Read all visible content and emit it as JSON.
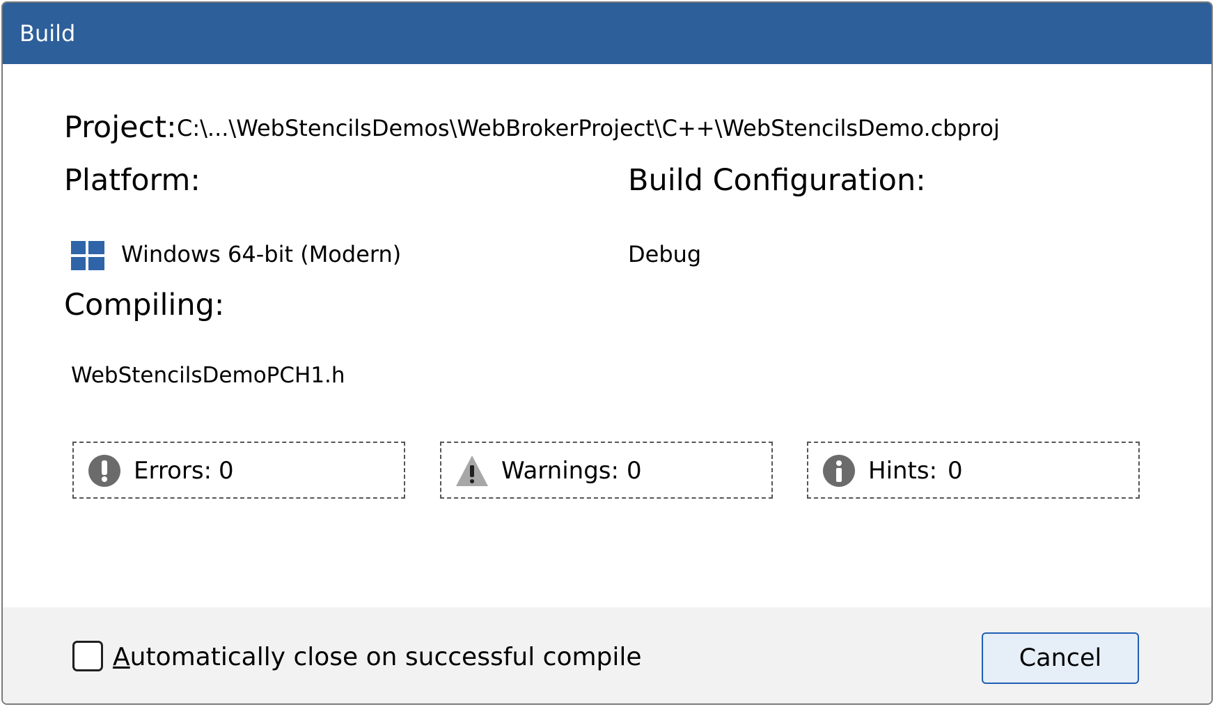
{
  "window": {
    "title": "Build"
  },
  "project": {
    "label": "Project:",
    "path": "C:\\...\\WebStencilsDemos\\WebBrokerProject\\C++\\WebStencilsDemo.cbproj"
  },
  "platform": {
    "label": "Platform:",
    "value": "Windows 64-bit (Modern)",
    "icon": "windows-logo-icon"
  },
  "build_configuration": {
    "label": "Build Configuration:",
    "value": "Debug"
  },
  "compiling": {
    "label": "Compiling:",
    "file": "WebStencilsDemoPCH1.h"
  },
  "status": {
    "errors": {
      "label": "Errors:",
      "count": "0",
      "icon": "error-icon"
    },
    "warnings": {
      "label": "Warnings:",
      "count": "0",
      "icon": "warning-icon"
    },
    "hints": {
      "label": "Hints:",
      "count": "0",
      "icon": "info-icon"
    }
  },
  "footer": {
    "auto_close": {
      "accelerator": "A",
      "label_rest": "utomatically close on successful compile",
      "checked": false
    },
    "cancel_label": "Cancel"
  },
  "colors": {
    "titlebar": "#2d5f9a",
    "windows_logo": "#2f64a8",
    "status_icon_dark": "#6b6b6b",
    "status_icon_light": "#a7a7a7",
    "footer_bg": "#f2f2f2",
    "button_border": "#1f5fb4"
  }
}
